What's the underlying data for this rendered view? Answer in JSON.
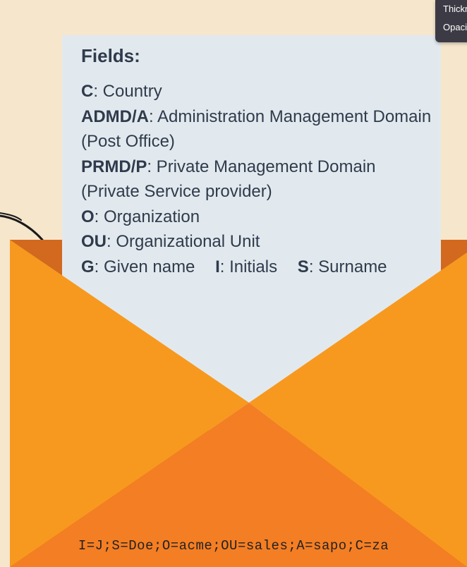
{
  "letter": {
    "title": "Fields:",
    "fields": [
      {
        "code": "C",
        "desc": ": Country"
      },
      {
        "code": "ADMD/A",
        "desc": ": Administration Management Domain (Post Office)"
      },
      {
        "code": "PRMD/P",
        "desc": ": Private Management Domain (Private Service provider)"
      },
      {
        "code": "O",
        "desc": ": Organization"
      },
      {
        "code": "OU",
        "desc": ": Organizational Unit"
      }
    ],
    "inline_fields": [
      {
        "code": "G",
        "desc": ": Given name"
      },
      {
        "code": "I",
        "desc": ": Initials"
      },
      {
        "code": "S",
        "desc": ": Surname"
      }
    ]
  },
  "envelope": {
    "address": "I=J;S=Doe;O=acme;OU=sales;A=sapo;C=za"
  },
  "tooltip": {
    "line1": "Thickn",
    "line2": "Opaci"
  },
  "colors": {
    "background": "#f5e6cc",
    "envelope_back": "#d2691e",
    "envelope_flap": "#f7991f",
    "envelope_bottom": "#f47e23",
    "letter": "#e2e9ee",
    "text": "#2f3b4c"
  }
}
